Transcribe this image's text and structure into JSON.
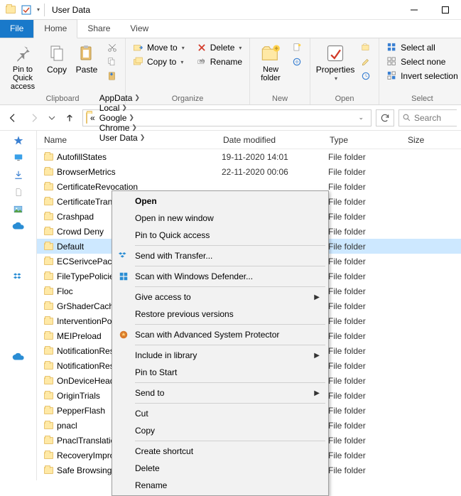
{
  "window": {
    "title": "User Data"
  },
  "ribbonTabs": {
    "file": "File",
    "home": "Home",
    "share": "Share",
    "view": "View"
  },
  "ribbon": {
    "clipboard": {
      "label": "Clipboard",
      "pin": "Pin to Quick access",
      "copy": "Copy",
      "paste": "Paste"
    },
    "organize": {
      "label": "Organize",
      "moveTo": "Move to",
      "copyTo": "Copy to",
      "delete": "Delete",
      "rename": "Rename"
    },
    "new": {
      "label": "New",
      "newFolder": "New folder"
    },
    "open": {
      "label": "Open",
      "properties": "Properties"
    },
    "select": {
      "label": "Select",
      "all": "Select all",
      "none": "Select none",
      "invert": "Invert selection"
    }
  },
  "breadcrumbs": [
    "AppData",
    "Local",
    "Google",
    "Chrome",
    "User Data"
  ],
  "searchPlaceholder": "Search",
  "columns": {
    "name": "Name",
    "date": "Date modified",
    "type": "Type",
    "size": "Size"
  },
  "typeLabel": "File folder",
  "rows": [
    {
      "name": "AutofillStates",
      "date": "19-11-2020 14:01"
    },
    {
      "name": "BrowserMetrics",
      "date": "22-11-2020 00:06"
    },
    {
      "name": "CertificateRevocation",
      "date": ""
    },
    {
      "name": "CertificateTransparency",
      "date": ""
    },
    {
      "name": "Crashpad",
      "date": ""
    },
    {
      "name": "Crowd Deny",
      "date": ""
    },
    {
      "name": "Default",
      "date": "",
      "selected": true
    },
    {
      "name": "ECSerivcePacks",
      "date": ""
    },
    {
      "name": "FileTypePolicies",
      "date": ""
    },
    {
      "name": "Floc",
      "date": ""
    },
    {
      "name": "GrShaderCache",
      "date": ""
    },
    {
      "name": "InterventionPolicyDb",
      "date": ""
    },
    {
      "name": "MEIPreload",
      "date": ""
    },
    {
      "name": "NotificationResources",
      "date": ""
    },
    {
      "name": "NotificationResources",
      "date": ""
    },
    {
      "name": "OnDeviceHeadSuggest",
      "date": ""
    },
    {
      "name": "OriginTrials",
      "date": ""
    },
    {
      "name": "PepperFlash",
      "date": ""
    },
    {
      "name": "pnacl",
      "date": ""
    },
    {
      "name": "PnaclTranslationCache",
      "date": ""
    },
    {
      "name": "RecoveryImproved",
      "date": ""
    },
    {
      "name": "Safe Browsing",
      "date": ""
    }
  ],
  "context": {
    "open": "Open",
    "openNew": "Open in new window",
    "pinQA": "Pin to Quick access",
    "sendTransfer": "Send with Transfer...",
    "scanDefender": "Scan with Windows Defender...",
    "giveAccess": "Give access to",
    "restore": "Restore previous versions",
    "scanASP": "Scan with Advanced System Protector",
    "include": "Include in library",
    "pinStart": "Pin to Start",
    "sendTo": "Send to",
    "cut": "Cut",
    "copy": "Copy",
    "shortcut": "Create shortcut",
    "delete": "Delete",
    "rename": "Rename"
  }
}
